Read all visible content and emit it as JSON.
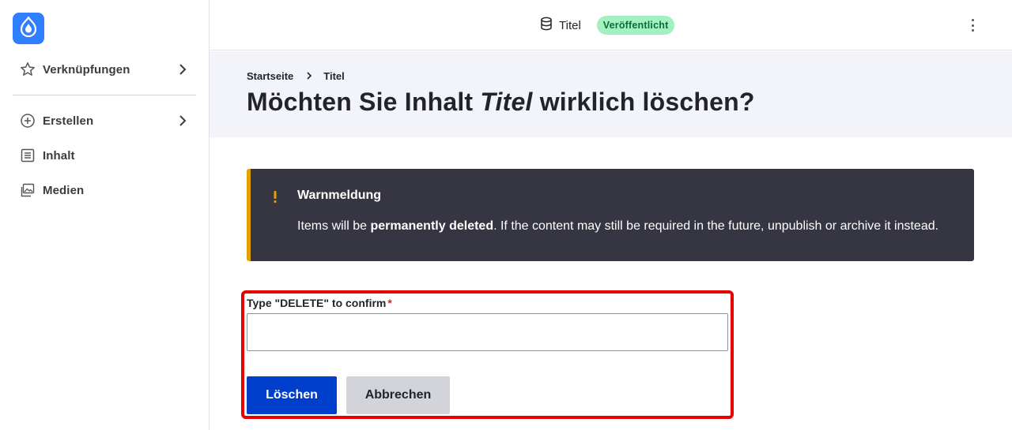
{
  "sidebar": {
    "items": [
      {
        "label": "Verknüpfungen",
        "icon": "star-icon"
      },
      {
        "label": "Erstellen",
        "icon": "plus-circle-icon"
      },
      {
        "label": "Inhalt",
        "icon": "list-icon"
      },
      {
        "label": "Medien",
        "icon": "image-icon"
      }
    ]
  },
  "topbar": {
    "title": "Titel",
    "status": "Veröffentlicht",
    "status_bg": "#a3f1c0"
  },
  "breadcrumb": {
    "home": "Startseite",
    "current": "Titel"
  },
  "page": {
    "title_prefix": "Möchten Sie Inhalt",
    "title_em": "Titel",
    "title_suffix": "wirklich löschen?"
  },
  "warning": {
    "title": "Warnmeldung",
    "text_before": "Items will be",
    "text_bold": "permanently deleted",
    "text_after": ". If the content may still be required in the future, unpublish or archive it instead."
  },
  "form": {
    "confirm_label": "Type \"DELETE\" to confirm",
    "required_mark": "*",
    "confirm_value": "",
    "delete_label": "Löschen",
    "cancel_label": "Abbrechen"
  },
  "colors": {
    "accent": "#003ecc",
    "warning_bar": "#e1a100",
    "highlight": "#e60000"
  }
}
